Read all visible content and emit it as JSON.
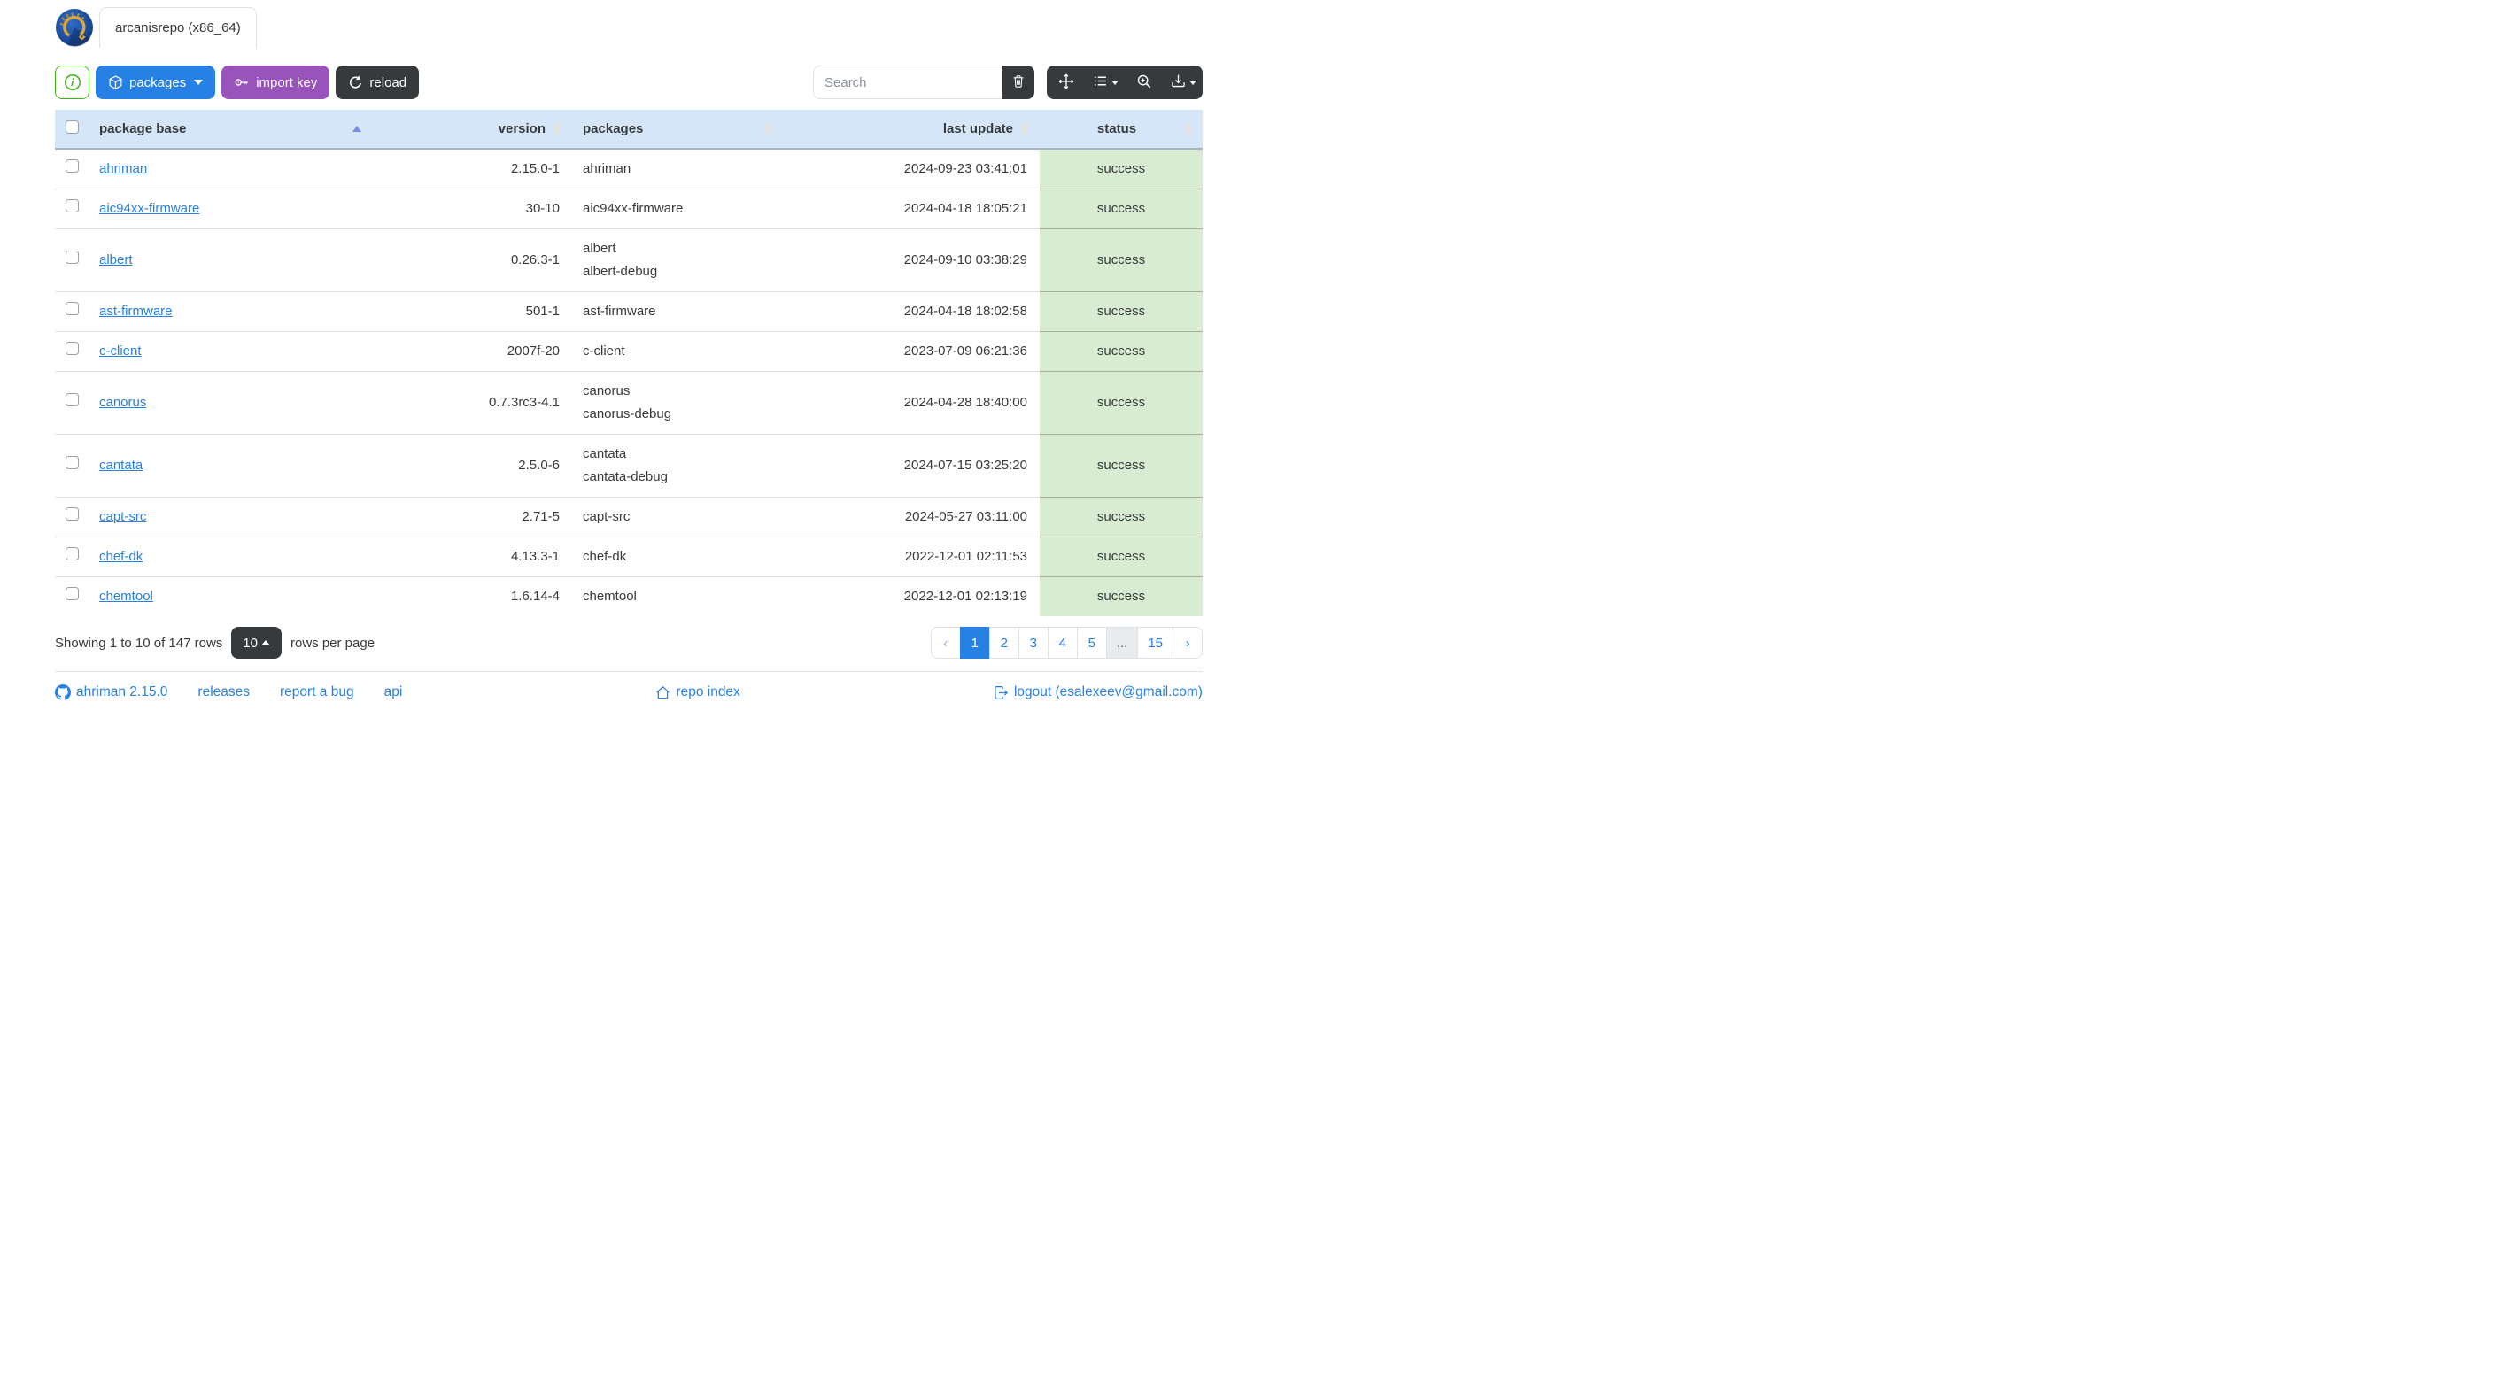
{
  "header": {
    "tab_label": "arcanisrepo (x86_64)"
  },
  "toolbar": {
    "packages_label": "packages",
    "import_key_label": "import key",
    "reload_label": "reload",
    "search_placeholder": "Search"
  },
  "table": {
    "columns": {
      "base": "package base",
      "version": "version",
      "packages": "packages",
      "last_update": "last update",
      "status": "status"
    },
    "sort": {
      "column": "package base",
      "direction": "asc"
    },
    "rows": [
      {
        "base": "ahriman",
        "version": "2.15.0-1",
        "packages": [
          "ahriman"
        ],
        "last_update": "2024-09-23 03:41:01",
        "status": "success"
      },
      {
        "base": "aic94xx-firmware",
        "version": "30-10",
        "packages": [
          "aic94xx-firmware"
        ],
        "last_update": "2024-04-18 18:05:21",
        "status": "success"
      },
      {
        "base": "albert",
        "version": "0.26.3-1",
        "packages": [
          "albert",
          "albert-debug"
        ],
        "last_update": "2024-09-10 03:38:29",
        "status": "success"
      },
      {
        "base": "ast-firmware",
        "version": "501-1",
        "packages": [
          "ast-firmware"
        ],
        "last_update": "2024-04-18 18:02:58",
        "status": "success"
      },
      {
        "base": "c-client",
        "version": "2007f-20",
        "packages": [
          "c-client"
        ],
        "last_update": "2023-07-09 06:21:36",
        "status": "success"
      },
      {
        "base": "canorus",
        "version": "0.7.3rc3-4.1",
        "packages": [
          "canorus",
          "canorus-debug"
        ],
        "last_update": "2024-04-28 18:40:00",
        "status": "success"
      },
      {
        "base": "cantata",
        "version": "2.5.0-6",
        "packages": [
          "cantata",
          "cantata-debug"
        ],
        "last_update": "2024-07-15 03:25:20",
        "status": "success"
      },
      {
        "base": "capt-src",
        "version": "2.71-5",
        "packages": [
          "capt-src"
        ],
        "last_update": "2024-05-27 03:11:00",
        "status": "success"
      },
      {
        "base": "chef-dk",
        "version": "4.13.3-1",
        "packages": [
          "chef-dk"
        ],
        "last_update": "2022-12-01 02:11:53",
        "status": "success"
      },
      {
        "base": "chemtool",
        "version": "1.6.14-4",
        "packages": [
          "chemtool"
        ],
        "last_update": "2022-12-01 02:13:19",
        "status": "success"
      }
    ]
  },
  "pagination": {
    "summary": "Showing 1 to 10 of 147 rows",
    "page_size": "10",
    "rows_per_page_label": "rows per page",
    "prev_label": "‹",
    "next_label": "›",
    "pages": [
      "1",
      "2",
      "3",
      "4",
      "5",
      "...",
      "15"
    ],
    "active_page": "1"
  },
  "footer": {
    "version_link": "ahriman 2.15.0",
    "releases_link": "releases",
    "report_bug_link": "report a bug",
    "api_link": "api",
    "repo_index_link": "repo index",
    "logout_link": "logout (esalexeev@gmail.com)"
  },
  "icons": {
    "info": "info-circle",
    "packages": "box",
    "import_key": "key",
    "reload": "arrow-clockwise",
    "clear_search": "trash",
    "fullscreen": "arrows-move",
    "columns": "list-with-caret",
    "zoom": "zoom-in",
    "export": "download-with-caret",
    "github": "github-mark",
    "repo_index": "house",
    "logout": "box-arrow-right",
    "sort_asc": "caret-up-filled",
    "sort_idle": "caret-up-down"
  },
  "colors": {
    "primary": "#2780e3",
    "info_purple": "#9954bb",
    "dark": "#373a3c",
    "success": "#3fb618",
    "table_header_bg": "#d4e6f8",
    "status_success_bg": "#d7ecd0",
    "link": "#2780e3"
  }
}
